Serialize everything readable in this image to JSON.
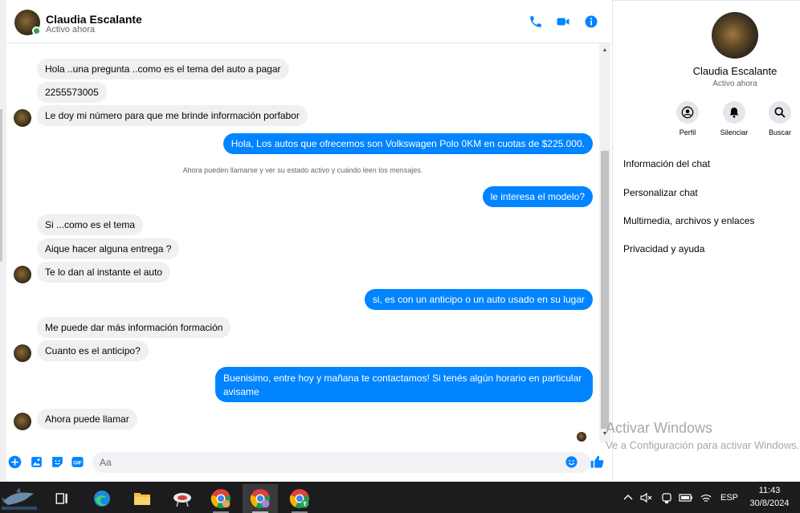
{
  "contact": {
    "name": "Claudia Escalante",
    "status": "Activo ahora"
  },
  "header": {
    "call_icon": "phone-icon",
    "video_icon": "video-icon",
    "info_icon": "info-icon"
  },
  "messages": [
    {
      "from": "in",
      "text": "Hola ..una pregunta ..como es el tema del auto a pagar"
    },
    {
      "from": "in",
      "text": "2255573005"
    },
    {
      "from": "in",
      "text": "Le doy mi número para que me brinde información porfabor"
    },
    {
      "from": "out",
      "text": "Hola, Los autos que ofrecemos son Volkswagen Polo 0KM en cuotas de $225.000."
    },
    {
      "from": "system",
      "text": "Ahora pueden llamarse y ver su estado activo y cuándo leen los mensajes."
    },
    {
      "from": "out",
      "text": "le interesa el modelo?"
    },
    {
      "from": "in",
      "text": "Si ...como es el tema"
    },
    {
      "from": "in",
      "text": "Aique hacer alguna entrega ?"
    },
    {
      "from": "in",
      "text": "Te lo dan al instante el auto"
    },
    {
      "from": "out",
      "text": "si, es con un anticipo o un auto usado en su lugar"
    },
    {
      "from": "in",
      "text": "Me puede dar más información formación"
    },
    {
      "from": "in",
      "text": "Cuanto es el anticipo?"
    },
    {
      "from": "out",
      "text": "Buenisimo, entre hoy y mañana te contactamos! Si tenés algún horario en particular avisame"
    },
    {
      "from": "in",
      "text": "Ahora puede llamar"
    }
  ],
  "composer": {
    "placeholder": "Aa",
    "icons": [
      "plus-icon",
      "image-icon",
      "sticker-icon",
      "gif-icon",
      "emoji-icon",
      "like-icon"
    ],
    "gif_label": "GIF"
  },
  "right_panel": {
    "name": "Claudia Escalante",
    "status": "Activo ahora",
    "actions": [
      {
        "label": "Perfil",
        "icon": "profile-icon"
      },
      {
        "label": "Silenciar",
        "icon": "bell-icon"
      },
      {
        "label": "Buscar",
        "icon": "search-icon"
      }
    ],
    "menu": [
      "Información del chat",
      "Personalizar chat",
      "Multimedia, archivos y enlaces",
      "Privacidad y ayuda"
    ]
  },
  "watermark": {
    "line1": "Activar Windows",
    "line2": "Ve a Configuración para activar Windows."
  },
  "taskbar": {
    "apps": [
      "shark-wallpaper-icon",
      "task-view-icon",
      "edge-icon",
      "file-explorer-icon",
      "app-icon",
      "chrome-icon",
      "chrome-profile-icon",
      "chrome-profile-t-icon"
    ],
    "language": "ESP",
    "time": "11:43",
    "date": "30/8/2024"
  },
  "colors": {
    "accent": "#0084ff",
    "incoming_bubble": "#f0f0f0",
    "online": "#31a24c"
  }
}
